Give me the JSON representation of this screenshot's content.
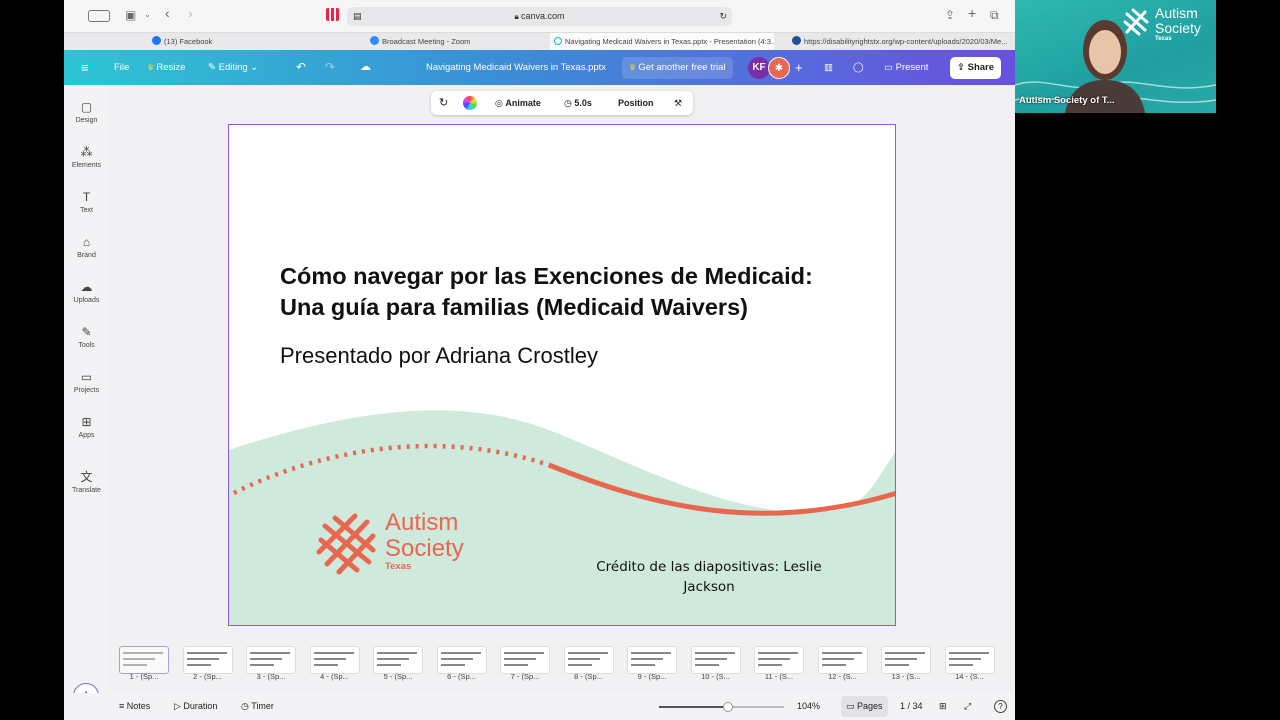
{
  "browser": {
    "url": "canva.com",
    "tabs": [
      {
        "label": "(13) Facebook",
        "color": "#1877f2"
      },
      {
        "label": "Broadcast Meeting - Zoom",
        "color": "#2d8cff"
      },
      {
        "label": "Navigating Medicaid Waivers in Texas.pptx - Presentation (4:3...",
        "color": "#00c4cc"
      },
      {
        "label": "https://disabilityrightstx.org/wp-content/uploads/2020/03/Me...",
        "color": "#1d4f91"
      }
    ]
  },
  "header": {
    "file": "File",
    "resize": "Resize",
    "editing": "Editing",
    "doc_title": "Navigating Medicaid Waivers in Texas.pptx",
    "trial": "Get another free trial",
    "avatar_initials": "KF",
    "present": "Present",
    "share": "Share"
  },
  "sidebar": {
    "items": [
      {
        "label": "Design",
        "icon": "design-icon"
      },
      {
        "label": "Elements",
        "icon": "elements-icon"
      },
      {
        "label": "Text",
        "icon": "text-icon"
      },
      {
        "label": "Brand",
        "icon": "brand-icon"
      },
      {
        "label": "Uploads",
        "icon": "uploads-icon"
      },
      {
        "label": "Tools",
        "icon": "tools-icon"
      },
      {
        "label": "Projects",
        "icon": "projects-icon"
      },
      {
        "label": "Apps",
        "icon": "apps-icon"
      },
      {
        "label": "Translate",
        "icon": "translate-icon"
      }
    ]
  },
  "context_toolbar": {
    "animate": "Animate",
    "duration": "5.0s",
    "position": "Position"
  },
  "slide": {
    "title_line1": "Cómo navegar por las Exenciones de Medicaid:",
    "title_line2": "Una guía para familias (Medicaid Waivers)",
    "subtitle": "Presentado por Adriana Crostley",
    "credit_line1": "Crédito de las diapositivas: Leslie",
    "credit_line2": "Jackson",
    "logo_line1": "Autism",
    "logo_line2": "Society",
    "logo_line3": "Texas",
    "colors": {
      "accent": "#e8674f",
      "wave": "#cfe9dc"
    }
  },
  "filmstrip": {
    "thumbs": [
      "1 - (Sp...",
      "2 - (Sp...",
      "3 - (Sp...",
      "4 - (Sp...",
      "5 - (Sp...",
      "6 - (Sp...",
      "7 - (Sp...",
      "8 - (Sp...",
      "9 - (Sp...",
      "10 - (S...",
      "11 - (S...",
      "12 - (S...",
      "13 - (S...",
      "14 - (S..."
    ]
  },
  "bottom_bar": {
    "notes": "Notes",
    "duration": "Duration",
    "timer": "Timer",
    "zoom": "104%",
    "pages": "Pages",
    "page_count": "1 / 34",
    "zoom_fraction": 0.55
  },
  "video": {
    "participant": "Autism Society of T...",
    "logo_line1": "Autism",
    "logo_line2": "Society",
    "logo_line3": "Texas"
  }
}
